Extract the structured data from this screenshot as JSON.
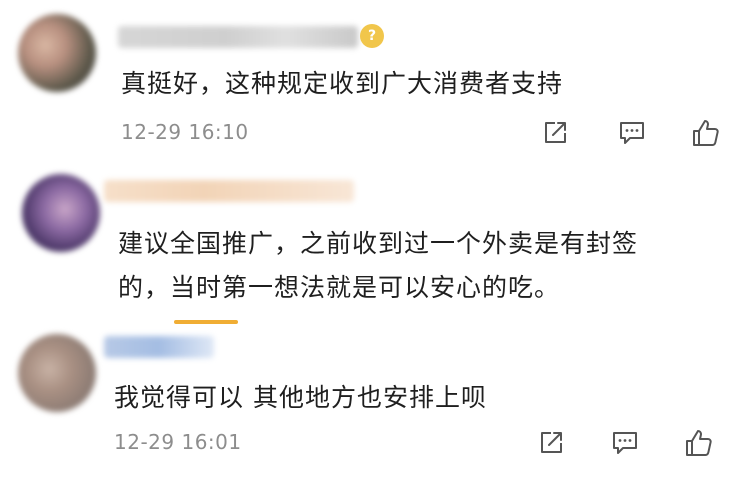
{
  "comments": [
    {
      "text": "真挺好，这种规定收到广大消费者支持",
      "timestamp": "12-29 16:10",
      "badge": "?"
    },
    {
      "text_line1": "建议全国推广，之前收到过一个外卖是有封签",
      "text_line2": "的，当时第一想法就是可以安心的吃。"
    },
    {
      "text": "我觉得可以 其他地方也安排上呗",
      "timestamp": "12-29 16:01"
    }
  ],
  "actions": {
    "share_icon": "share-icon",
    "comment_icon": "comment-icon",
    "like_icon": "thumbs-up-icon"
  },
  "colors": {
    "highlight_underline": "#f0ad34",
    "badge": "#f1c64b",
    "timestamp": "#8d8d8d",
    "text": "#1f1f1f"
  }
}
